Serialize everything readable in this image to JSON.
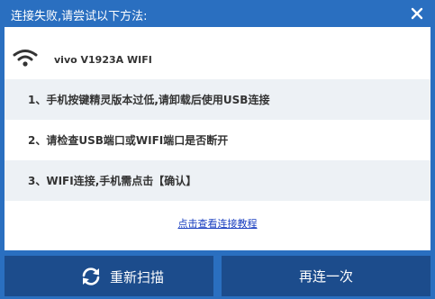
{
  "dialog": {
    "title": "连接失败,请尝试以下方法:",
    "close_icon": "close-icon"
  },
  "device": {
    "icon": "wifi-icon",
    "name": "vivo V1923A  WIFI"
  },
  "steps": [
    {
      "text": "1、手机按键精灵版本过低,请卸载后使用USB连接"
    },
    {
      "text": "2、请检查USB端口或WIFI端口是否断开"
    },
    {
      "text": "3、WIFI连接,手机需点击【确认】"
    }
  ],
  "tutorial_link": "点击查看连接教程",
  "buttons": {
    "rescan_label": "重新扫描",
    "rescan_icon": "refresh-icon",
    "reconnect_label": "再连一次"
  },
  "colors": {
    "window_blue": "#2a6fc0",
    "button_dark_blue": "#1c4c8c",
    "link_blue": "#1a3fc0",
    "row_alt": "#edf1f5"
  }
}
